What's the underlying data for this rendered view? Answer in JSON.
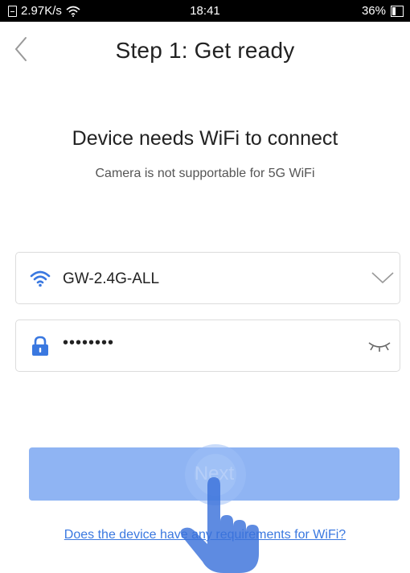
{
  "status_bar": {
    "network_speed": "2.97K/s",
    "time": "18:41",
    "battery_percent": "36%",
    "battery_level": 0.36
  },
  "header": {
    "title": "Step 1: Get ready"
  },
  "main": {
    "heading": "Device needs WiFi to connect",
    "subheading": "Camera is not supportable for 5G WiFi",
    "wifi_field": {
      "value": "GW-2.4G-ALL",
      "icon": "wifi-icon"
    },
    "password_field": {
      "value": "••••••••",
      "icon": "lock-icon"
    },
    "next_label": "Next",
    "help_link": "Does the device have any requirements for WiFi?"
  },
  "colors": {
    "accent": "#3a78e0",
    "button": "#8fb4f3",
    "border": "#dcdcdc"
  }
}
